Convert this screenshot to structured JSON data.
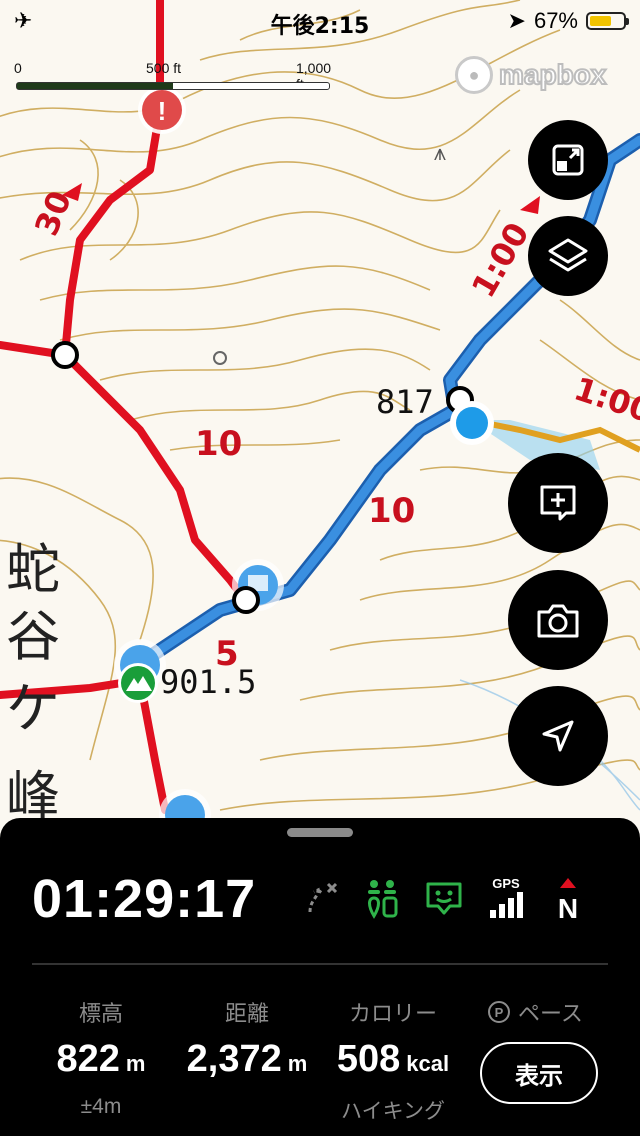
{
  "status_bar": {
    "time": "午後2:15",
    "battery_percent": "67%",
    "battery_level": 0.67,
    "icons": [
      "airplane-icon",
      "location-arrow-icon",
      "battery-icon"
    ]
  },
  "map": {
    "scale_labels": [
      "0",
      "500 ft",
      "1,000 ft"
    ],
    "attribution": "mapbox",
    "labels": {
      "route_30": "30",
      "route_10a": "10",
      "route_10b": "10",
      "route_5": "5",
      "time_1": "1:00",
      "time_2": "1:00",
      "elev_817": "817",
      "elev_901": "901.5",
      "place_1": "蛇",
      "place_2": "谷",
      "place_3": "ケ",
      "place_4": "峰"
    },
    "colors": {
      "route_red": "#e01020",
      "track_blue": "#3a8fe0",
      "contour": "#c9a24a",
      "position": "#1e9be8"
    }
  },
  "fabs": {
    "fit_icon": "fit-bounds-icon",
    "layers_icon": "layers-icon",
    "add_note_icon": "add-note-icon",
    "camera_icon": "camera-icon",
    "navigate_icon": "navigation-arrow-icon"
  },
  "panel": {
    "elapsed_time": "01:29:17",
    "status_icons": {
      "gps_label": "GPS",
      "compass_label": "N"
    },
    "stats": {
      "elevation": {
        "label": "標高",
        "value": "822",
        "unit": "m",
        "sub": "±4m"
      },
      "distance": {
        "label": "距離",
        "value": "2,372",
        "unit": "m"
      },
      "calories": {
        "label": "カロリー",
        "value": "508",
        "unit": "kcal",
        "sub": "ハイキング"
      }
    },
    "pace": {
      "badge": "P",
      "label": "ペース"
    },
    "show_button": "表示"
  }
}
